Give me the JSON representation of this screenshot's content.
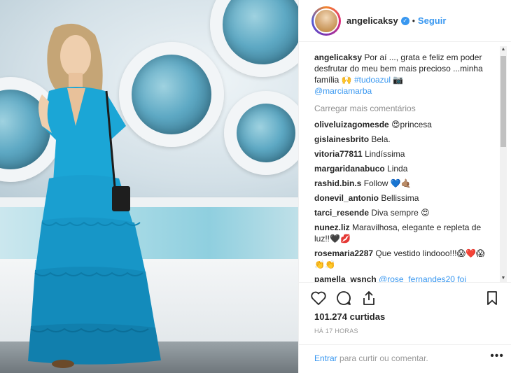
{
  "post": {
    "username": "angelicaksy",
    "follow_label": "Seguir",
    "separator": "•",
    "caption_user": "angelicaksy",
    "caption_text": "Por aí ..., grata e feliz em poder desfrutar do meu bem mais precioso ...minha família 🙌",
    "caption_hashtag": "#tudoazul",
    "caption_camera": "📷",
    "caption_mention": "@marciamarba",
    "load_more": "Carregar mais comentários",
    "likes": "101.274 curtidas",
    "timestamp": "HÁ 17 HORAS"
  },
  "comments": [
    {
      "user": "oliveluizagomesde",
      "text": "😍princesa"
    },
    {
      "user": "gislainesbrito",
      "text": "Bela."
    },
    {
      "user": "vitoria77811",
      "text": "Lindíssima"
    },
    {
      "user": "margaridanabuco",
      "text": "Linda"
    },
    {
      "user": "rashid.bin.s",
      "text": "Follow 💙🤙🏽"
    },
    {
      "user": "donevil_antonio",
      "text": "Bellissima"
    },
    {
      "user": "tarci_resende",
      "text": "Diva sempre 😍"
    },
    {
      "user": "nunez.liz",
      "text": "Maravilhosa, elegante e repleta de luz!!🖤💋"
    },
    {
      "user": "rosemaria2287",
      "text": "Que vestido lindooo!!!😱❤️😱👏👏"
    },
    {
      "user": "pamella_wsnch",
      "text": "@rose_fernandes20 foi"
    }
  ],
  "footer": {
    "enter_label": "Entrar",
    "rest": " para curtir ou comentar.",
    "more_label": "•••"
  },
  "icons": {
    "like": "heart-icon",
    "comment": "comment-icon",
    "share": "share-icon",
    "save": "bookmark-icon"
  },
  "colors": {
    "link": "#3897f0",
    "muted": "#8e8e8e",
    "dress": "#1aa3d4"
  }
}
